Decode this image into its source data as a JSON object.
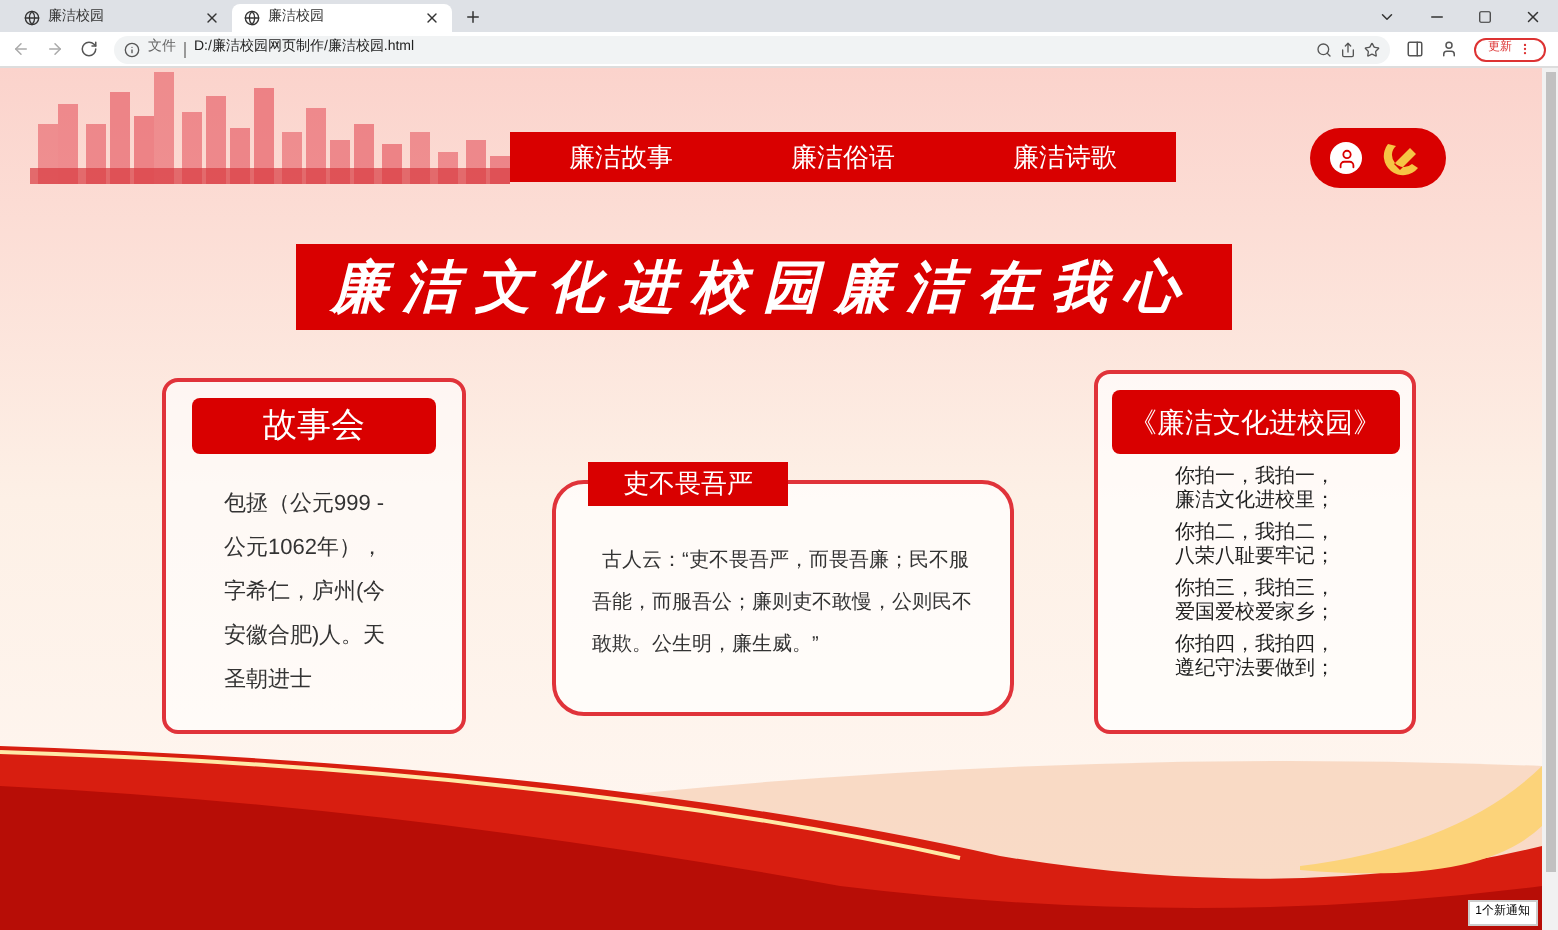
{
  "browser": {
    "tabs": [
      {
        "title": "廉洁校园",
        "selected": false
      },
      {
        "title": "廉洁校园",
        "selected": true
      }
    ],
    "address": {
      "scheme": "文件",
      "url": "D:/廉洁校园网页制作/廉洁校园.html"
    },
    "update_button": "更新"
  },
  "nav": [
    {
      "label": "廉洁故事"
    },
    {
      "label": "廉洁俗语"
    },
    {
      "label": "廉洁诗歌"
    }
  ],
  "title": "廉洁文化进校园廉洁在我心",
  "cards": [
    {
      "kind": "story",
      "heading": "故事会",
      "body": "包拯（公元999 - 公元1062年），字希仁，庐州(今安徽合肥)人。天圣朝进士"
    },
    {
      "kind": "quote",
      "heading": "吏不畏吾严",
      "body": "古人云：“吏不畏吾严，而畏吾廉；民不服吾能，而服吾公；廉则吏不敢慢，公则民不敢欺。公生明，廉生威。”"
    },
    {
      "kind": "poem",
      "heading": "《廉洁文化进校园》",
      "stanzas": [
        [
          "你拍一，我拍一，",
          "廉洁文化进校里；"
        ],
        [
          "你拍二，我拍二，",
          "八荣八耻要牢记；"
        ],
        [
          "你拍三，我拍三，",
          "爱国爱校爱家乡；"
        ],
        [
          "你拍四，我拍四，",
          "遵纪守法要做到；"
        ]
      ]
    }
  ],
  "notification": "1个新通知"
}
